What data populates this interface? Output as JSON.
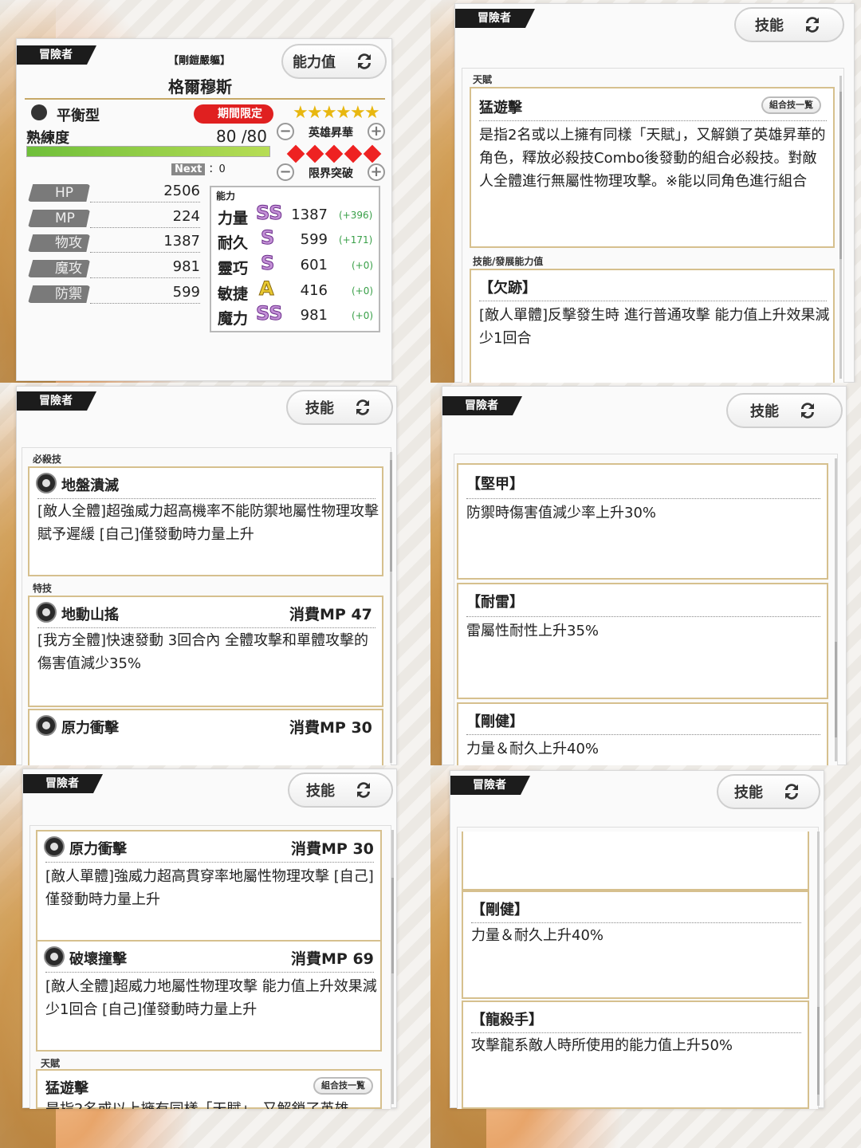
{
  "common": {
    "adventurer_tag": "冒險者",
    "skills_tab": "技能",
    "combo_list": "組合技一覧"
  },
  "colors": {
    "accent_gold": "#d6c08e",
    "limited_red": "#e02020",
    "rank_purple": "#c38fd6",
    "bonus_green": "#3aa049"
  },
  "cell1": {
    "tab": "能力值",
    "epithet": "【剛鎧嚴軀】",
    "name": "格爾穆斯",
    "type": "平衡型",
    "limited_badge": "期間限定",
    "proficiency_label": "熟練度",
    "proficiency_value": "80",
    "proficiency_max": "/80",
    "proficiency_fill": 1.0,
    "next_label": "Next",
    "next_value": "：0",
    "hero_ascend": "英雄昇華",
    "limit_break": "限界突破",
    "stars": 6,
    "diamonds": 5,
    "stats": [
      {
        "label": "HP",
        "value": "2506"
      },
      {
        "label": "MP",
        "value": "224"
      },
      {
        "label": "物攻",
        "value": "1387"
      },
      {
        "label": "魔攻",
        "value": "981"
      },
      {
        "label": "防禦",
        "value": "599"
      }
    ],
    "abilities_label": "能力",
    "abilities": [
      {
        "name": "力量",
        "rank": "SS",
        "value": "1387",
        "bonus": "(+396)"
      },
      {
        "name": "耐久",
        "rank": "S",
        "value": "599",
        "bonus": "(+171)"
      },
      {
        "name": "靈巧",
        "rank": "S",
        "value": "601",
        "bonus": "(+0)"
      },
      {
        "name": "敏捷",
        "rank": "A",
        "value": "416",
        "bonus": "(+0)"
      },
      {
        "name": "魔力",
        "rank": "SS",
        "value": "981",
        "bonus": "(+0)"
      }
    ]
  },
  "cell2": {
    "talent_label": "天賦",
    "talent_title": "猛遊擊",
    "talent_text": "是指2名或以上擁有同樣「天賦」，又解鎖了英雄昇華的角色，釋放必殺技Combo後發動的組合必殺技。對敵人全體進行無屬性物理攻擊。※能以同角色進行組合",
    "dev_label": "技能/發展能力值",
    "dev_title": "【欠跡】",
    "dev_text": "[敵人單體]反擊發生時 進行普通攻擊 能力值上升效果減少1回合"
  },
  "cell3": {
    "special_label": "必殺技",
    "special_title": "地盤潰滅",
    "special_text": "[敵人全體]超強威力超高機率不能防禦地屬性物理攻擊 賦予遲緩 [自己]僅發動時力量上升",
    "skill_label": "特技",
    "skill1_title": "地動山搖",
    "skill1_cost": "消費MP 47",
    "skill1_text": "[我方全體]快速發動 3回合內 全體攻擊和單體攻擊的傷害值減少35%",
    "skill2_title": "原力衝擊",
    "skill2_cost": "消費MP 30"
  },
  "cell4": {
    "d1_title": "【堅甲】",
    "d1_text": "防禦時傷害值減少率上升30%",
    "d2_title": "【耐雷】",
    "d2_text": "雷屬性耐性上升35%",
    "d3_title": "【剛健】",
    "d3_text": "力量＆耐久上升40%"
  },
  "cell5": {
    "s1_title": "原力衝擊",
    "s1_cost": "消費MP 30",
    "s1_text": "[敵人單體]強威力超高貫穿率地屬性物理攻擊 [自己]僅發動時力量上升",
    "s2_title": "破壞撞擊",
    "s2_cost": "消費MP 69",
    "s2_text": "[敵人全體]超威力地屬性物理攻擊 能力值上升效果減少1回合 [自己]僅發動時力量上升",
    "talent_label": "天賦",
    "talent_title": "猛遊擊",
    "talent_cut": "是指2名或以上擁有同樣「天賦」，又解鎖了英雄"
  },
  "cell6": {
    "d1_title": "【剛健】",
    "d1_text": "力量＆耐久上升40%",
    "d2_title": "【龍殺手】",
    "d2_text": "攻擊龍系敵人時所使用的能力值上升50%"
  }
}
